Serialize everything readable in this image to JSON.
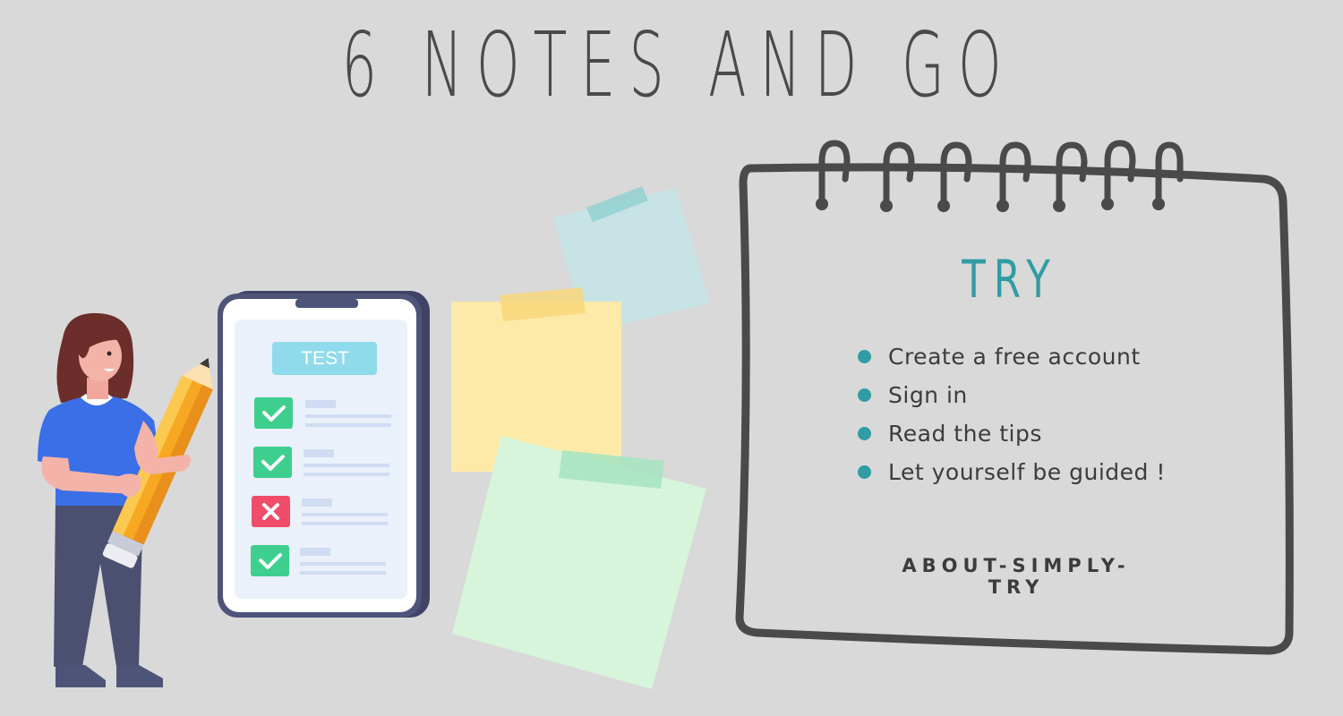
{
  "header": {
    "title": "6 NOTES AND GO"
  },
  "phone": {
    "label": "TEST"
  },
  "notebook": {
    "title": "TRY",
    "items": [
      {
        "label": "Create a free account"
      },
      {
        "label": "Sign in"
      },
      {
        "label": "Read the tips"
      },
      {
        "label": "Let yourself be guided !"
      }
    ],
    "footer": "ABOUT-SIMPLY-TRY"
  },
  "colors": {
    "background": "#d9d9d9",
    "accent": "#2f9da3",
    "ink": "#4a4a4a",
    "check": "#3ecf8e",
    "cross": "#ef4d6a",
    "note_blue": "#c8e3e6",
    "note_yellow": "#fdeaa8",
    "note_green": "#d6f5da"
  }
}
